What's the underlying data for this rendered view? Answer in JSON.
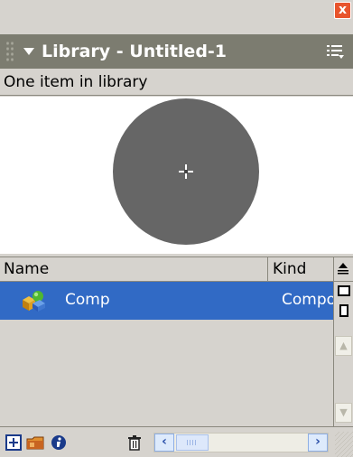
{
  "window": {
    "close_label": "x"
  },
  "panel": {
    "title": "Library - Untitled-1"
  },
  "status": {
    "item_count_text": "One item in library"
  },
  "columns": {
    "name": "Name",
    "kind": "Kind"
  },
  "items": [
    {
      "name": "Comp",
      "kind": "Component",
      "icon": "component-icon",
      "selected": true
    }
  ],
  "colors": {
    "header_bg": "#7c7c70",
    "selection": "#316ac5",
    "preview_shape": "#666666",
    "panel_bg": "#d6d3ce"
  },
  "toolbar": {
    "icons": [
      "new-symbol-icon",
      "new-folder-icon",
      "properties-icon",
      "delete-icon"
    ]
  }
}
